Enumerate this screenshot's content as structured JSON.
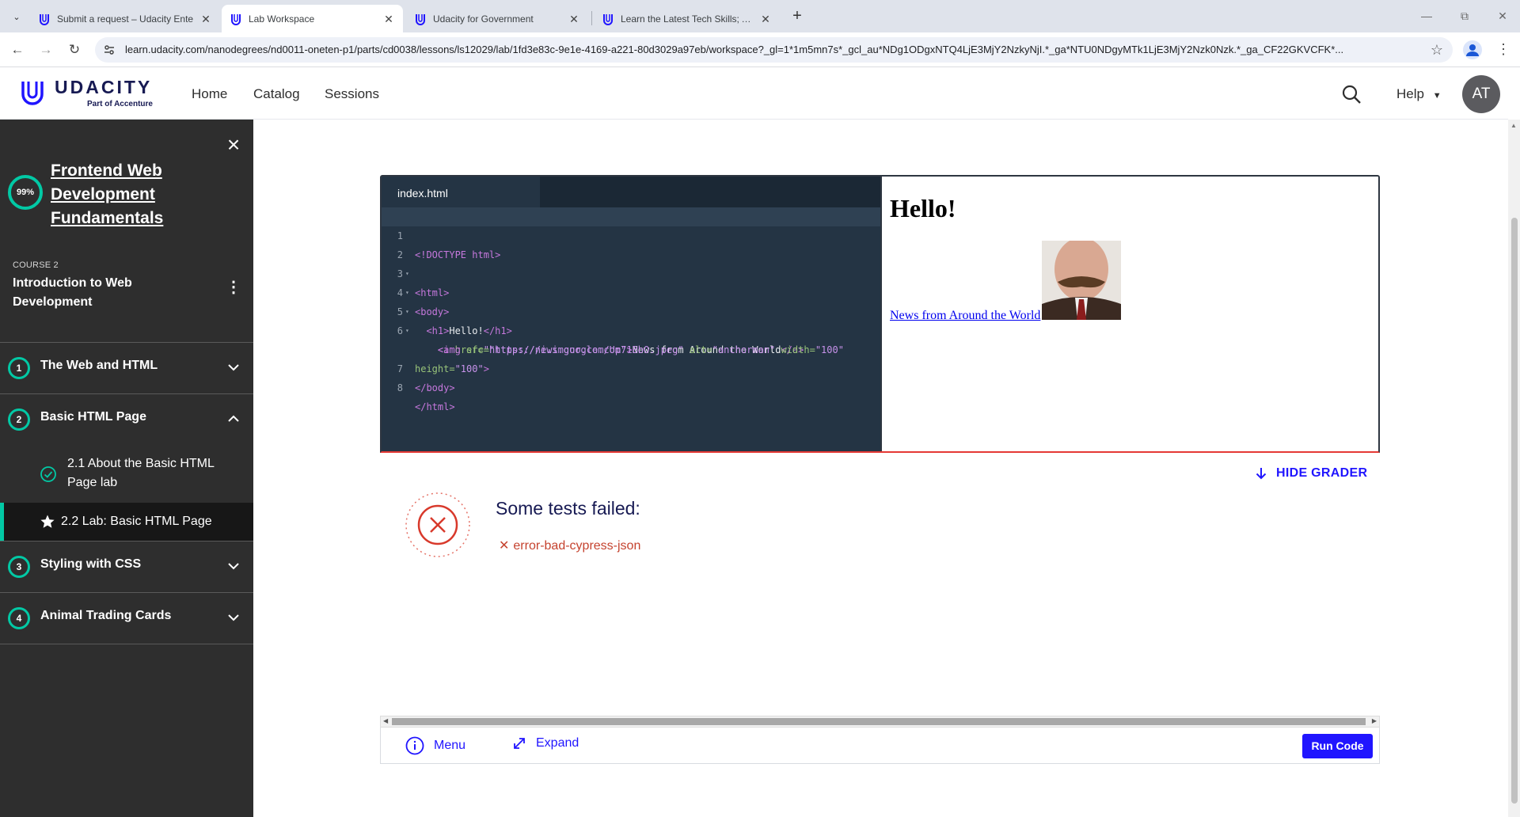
{
  "browser": {
    "tabs": [
      {
        "title": "Submit a request – Udacity Ente",
        "active": false
      },
      {
        "title": "Lab Workspace",
        "active": true
      },
      {
        "title": "Udacity for Government",
        "active": false
      },
      {
        "title": "Learn the Latest Tech Skills; Adv",
        "active": false
      }
    ],
    "url": "learn.udacity.com/nanodegrees/nd0011-oneten-p1/parts/cd0038/lessons/ls12029/lab/1fd3e83c-9e1e-4169-a221-80d3029a97eb/workspace?_gl=1*1m5mn7s*_gcl_au*NDg1ODgxNTQ4LjE3MjY2NzkyNjI.*_ga*NTU0NDgyMTk1LjE3MjY2Nzk0Nzk.*_ga_CF22GKVCFK*..."
  },
  "header": {
    "logo_word": "UDACITY",
    "logo_sub": "Part of Accenture",
    "nav": [
      "Home",
      "Catalog",
      "Sessions"
    ],
    "help_label": "Help",
    "avatar_initials": "AT"
  },
  "sidebar": {
    "progress": "99%",
    "program_title": "Frontend Web Development Fundamentals",
    "course_label": "COURSE 2",
    "course_title": "Introduction to Web Development",
    "lessons": [
      {
        "num": "1",
        "name": "The Web and HTML"
      },
      {
        "num": "2",
        "name": "Basic HTML Page"
      },
      {
        "num": "3",
        "name": "Styling with CSS"
      },
      {
        "num": "4",
        "name": "Animal Trading Cards"
      }
    ],
    "concepts": [
      {
        "label": "2.1  About the Basic HTML Page lab"
      },
      {
        "label": "2.2  Lab: Basic HTML Page"
      }
    ]
  },
  "editor": {
    "tab": "index.html",
    "line_numbers": [
      "1",
      "2",
      "3",
      "4",
      "5",
      "6",
      "",
      "7",
      "8"
    ]
  },
  "preview": {
    "heading": "Hello!",
    "link_text": "News from Around the World"
  },
  "grader": {
    "hide_label": "HIDE GRADER",
    "result_title": "Some tests failed:",
    "failures": [
      "error-bad-cypress-json"
    ]
  },
  "bottombar": {
    "menu_label": "Menu",
    "expand_label": "Expand",
    "run_label": "Run Code"
  },
  "colors": {
    "brand_blue": "#2015ff",
    "teal": "#02c9a5",
    "error_red": "#c5432f",
    "sidebar_bg": "#2e2e2e",
    "editor_bg": "#243444"
  }
}
